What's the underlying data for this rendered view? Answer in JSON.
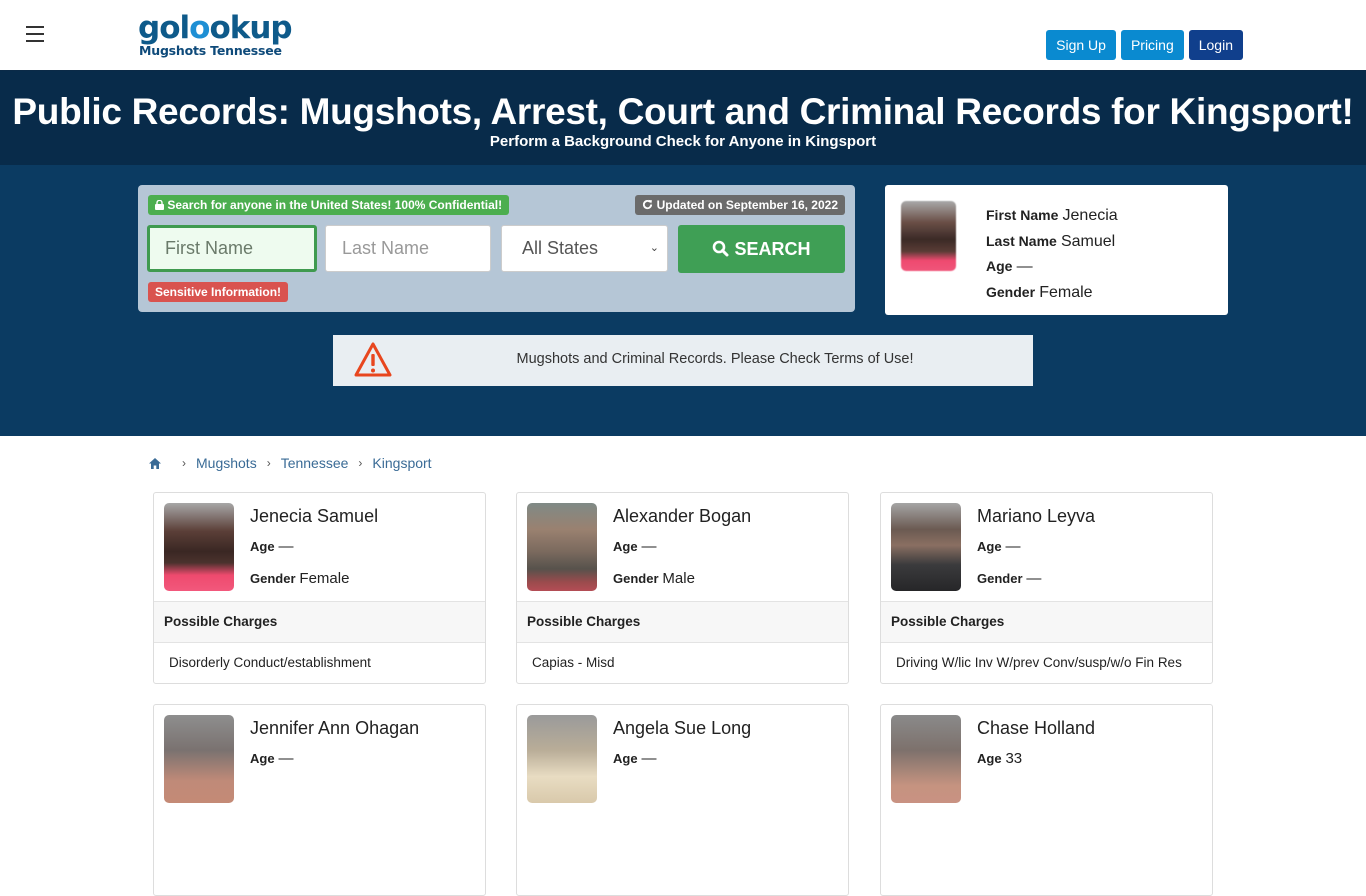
{
  "header": {
    "logo_main_a": "gol",
    "logo_main_b": "o",
    "logo_main_c": "okup",
    "logo_sub": "Mugshots Tennessee",
    "buttons": {
      "signup": "Sign Up",
      "pricing": "Pricing",
      "login": "Login"
    },
    "colors": {
      "signup": "#0a8ad0",
      "pricing": "#0a8ad0",
      "login": "#103f8c"
    }
  },
  "hero": {
    "title": "Public Records: Mugshots, Arrest, Court and Criminal Records for Kingsport!",
    "subtitle": "Perform a Background Check for Anyone in Kingsport"
  },
  "search": {
    "confidential_badge": "Search for anyone in the United States! 100% Confidential!",
    "updated_badge": "Updated on September 16, 2022",
    "first_name_placeholder": "First Name",
    "last_name_placeholder": "Last Name",
    "state_selected": "All States",
    "search_button": "SEARCH",
    "sensitive_badge": "Sensitive Information!"
  },
  "profile": {
    "first_name_label": "First Name",
    "first_name": "Jenecia",
    "last_name_label": "Last Name",
    "last_name": "Samuel",
    "age_label": "Age",
    "age": "—",
    "gender_label": "Gender",
    "gender": "Female"
  },
  "notice": {
    "text": "Mugshots and Criminal Records. Please Check Terms of Use!"
  },
  "breadcrumb": [
    "Mugshots",
    "Tennessee",
    "Kingsport"
  ],
  "labels": {
    "age": "Age",
    "gender": "Gender",
    "possible_charges": "Possible Charges"
  },
  "records": [
    {
      "name": "Jenecia Samuel",
      "age": "—",
      "gender": "Female",
      "charge": "Disorderly Conduct/establishment"
    },
    {
      "name": "Alexander Bogan",
      "age": "—",
      "gender": "Male",
      "charge": "Capias - Misd"
    },
    {
      "name": "Mariano Leyva",
      "age": "—",
      "gender": "—",
      "charge": "Driving W/lic Inv W/prev Conv/susp/w/o Fin Res"
    },
    {
      "name": "Jennifer Ann Ohagan",
      "age": "—"
    },
    {
      "name": "Angela Sue Long",
      "age": "—"
    },
    {
      "name": "Chase Holland",
      "age": "33"
    }
  ]
}
